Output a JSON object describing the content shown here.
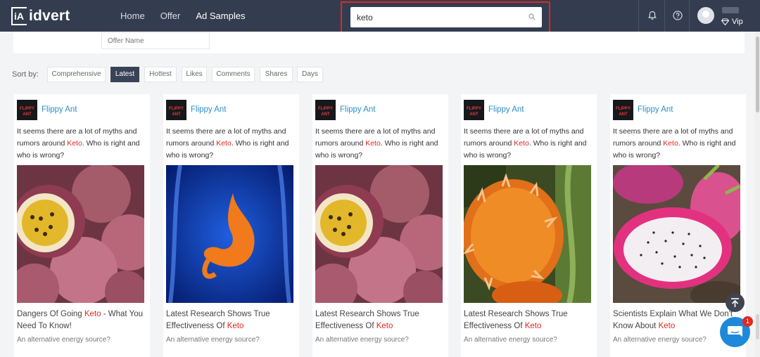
{
  "header": {
    "logo_mark": "iA",
    "logo_text": "idvert",
    "nav": [
      {
        "label": "Home",
        "active": false
      },
      {
        "label": "Offer",
        "active": false
      },
      {
        "label": "Ad Samples",
        "active": true
      }
    ],
    "search": {
      "value": "keto",
      "icon": "search-icon"
    },
    "icons": [
      "bell-icon",
      "help-icon"
    ],
    "user": {
      "badge": "Vip"
    },
    "colors": {
      "bar": "#343d4f",
      "highlight": "#e0281f"
    }
  },
  "filter": {
    "offer_placeholder": "Offer Name"
  },
  "sort": {
    "label": "Sort by:",
    "options": [
      "Comprehensive",
      "Latest",
      "Hottest",
      "Likes",
      "Comments",
      "Shares",
      "Days"
    ],
    "active": "Latest"
  },
  "cards": [
    {
      "brand": "Flippy Ant",
      "brand_logo": "FLIPPY ANT",
      "text_before": "It seems there are a lot of myths and rumors around ",
      "keyword": "Keto",
      "text_after": ". Who is right and who is wrong?",
      "image": "passion-fruit",
      "title_before": "Dangers Of Going ",
      "title_kw": "Keto",
      "title_after": " - What You Need To Know!",
      "subtitle": "An alternative energy source?"
    },
    {
      "brand": "Flippy Ant",
      "brand_logo": "FLIPPY ANT",
      "text_before": "It seems there are a lot of myths and rumors around ",
      "keyword": "Keto",
      "text_after": ". Who is right and who is wrong?",
      "image": "stomach-xray",
      "title_before": "Latest Research Shows True Effectiveness Of ",
      "title_kw": "Keto",
      "title_after": "",
      "subtitle": "An alternative energy source?"
    },
    {
      "brand": "Flippy Ant",
      "brand_logo": "FLIPPY ANT",
      "text_before": "It seems there are a lot of myths and rumors around ",
      "keyword": "Keto",
      "text_after": ". Who is right and who is wrong?",
      "image": "passion-fruit",
      "title_before": "Latest Research Shows True Effectiveness Of ",
      "title_kw": "Keto",
      "title_after": "",
      "subtitle": "An alternative energy source?"
    },
    {
      "brand": "Flippy Ant",
      "brand_logo": "FLIPPY ANT",
      "text_before": "It seems there are a lot of myths and rumors around ",
      "keyword": "Keto",
      "text_after": ". Who is right and who is wrong?",
      "image": "horned-melon",
      "title_before": "Latest Research Shows True Effectiveness Of ",
      "title_kw": "Keto",
      "title_after": "",
      "subtitle": "An alternative energy source?"
    },
    {
      "brand": "Flippy Ant",
      "brand_logo": "FLIPPY ANT",
      "text_before": "It seems there are a lot of myths and rumors around ",
      "keyword": "Keto",
      "text_after": ". Who is right and who is wrong?",
      "image": "dragon-fruit",
      "title_before": "Scientists Explain What We Don't Know About ",
      "title_kw": "Keto",
      "title_after": "",
      "subtitle": "An alternative energy source?"
    }
  ],
  "floating": {
    "chat_badge": "1",
    "icons": [
      "arrow-up-icon",
      "chat-icon"
    ]
  }
}
